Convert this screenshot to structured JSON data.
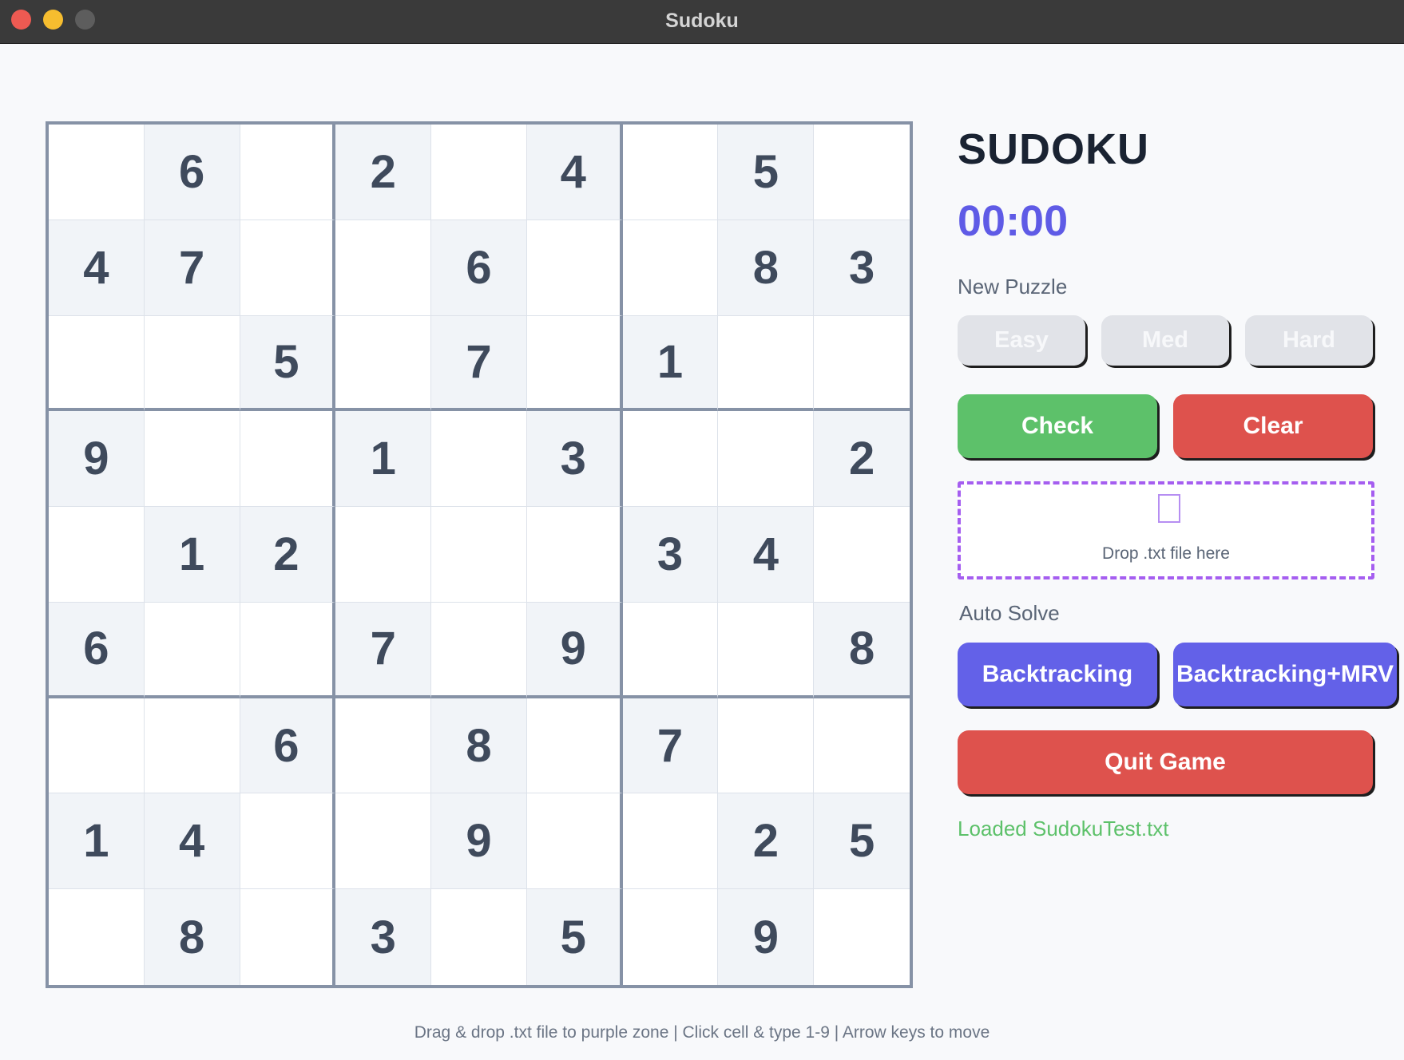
{
  "window": {
    "title": "Sudoku"
  },
  "board": {
    "grid": [
      [
        0,
        6,
        0,
        2,
        0,
        4,
        0,
        5,
        0
      ],
      [
        4,
        7,
        0,
        0,
        6,
        0,
        0,
        8,
        3
      ],
      [
        0,
        0,
        5,
        0,
        7,
        0,
        1,
        0,
        0
      ],
      [
        9,
        0,
        0,
        1,
        0,
        3,
        0,
        0,
        2
      ],
      [
        0,
        1,
        2,
        0,
        0,
        0,
        3,
        4,
        0
      ],
      [
        6,
        0,
        0,
        7,
        0,
        9,
        0,
        0,
        8
      ],
      [
        0,
        0,
        6,
        0,
        8,
        0,
        7,
        0,
        0
      ],
      [
        1,
        4,
        0,
        0,
        9,
        0,
        0,
        2,
        5
      ],
      [
        0,
        8,
        0,
        3,
        0,
        5,
        0,
        9,
        0
      ]
    ]
  },
  "panel": {
    "title": "SUDOKU",
    "timer": "00:00",
    "new_puzzle_label": "New Puzzle",
    "difficulty": {
      "easy": "Easy",
      "med": "Med",
      "hard": "Hard"
    },
    "check_label": "Check",
    "clear_label": "Clear",
    "dropzone": {
      "text": "Drop .txt file here",
      "icon": "file-icon"
    },
    "auto_solve_label": "Auto Solve",
    "solvers": {
      "backtracking": "Backtracking",
      "mrv": "Backtracking+MRV"
    },
    "quit_label": "Quit Game",
    "status": "Loaded SudokuTest.txt"
  },
  "footer": {
    "hint": "Drag & drop .txt file to purple zone | Click cell & type 1-9 | Arrow keys to move"
  },
  "colors": {
    "accent": "#6361e8",
    "success": "#5dc16a",
    "danger": "#de524d",
    "dropzone_border": "#a55ef0"
  }
}
